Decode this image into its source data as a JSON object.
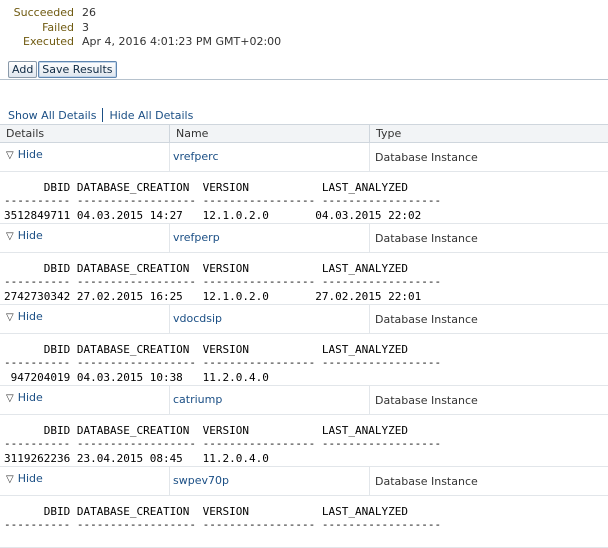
{
  "summary": {
    "succeeded_label": "Succeeded",
    "succeeded_value": "26",
    "failed_label": "Failed",
    "failed_value": "3",
    "executed_label": "Executed",
    "executed_value": "Apr 4, 2016 4:01:23 PM GMT+02:00"
  },
  "toolbar": {
    "add_label": "Add",
    "save_label": "Save Results"
  },
  "links": {
    "show_all": "Show All Details",
    "hide_all": "Hide All Details"
  },
  "table": {
    "columns": [
      "Details",
      "Name",
      "Type"
    ],
    "toggle_label": "Hide",
    "detail_header": "      DBID DATABASE_CREATION  VERSION           LAST_ANALYZED",
    "detail_dashes": "---------- ------------------ ----------------- ------------------",
    "rows": [
      {
        "name": "vrefperc",
        "type": "Database Instance",
        "value_line": "3512849711 04.03.2015 14:27   12.1.0.2.0       04.03.2015 22:02"
      },
      {
        "name": "vrefperp",
        "type": "Database Instance",
        "value_line": "2742730342 27.02.2015 16:25   12.1.0.2.0       27.02.2015 22:01"
      },
      {
        "name": "vdocdsip",
        "type": "Database Instance",
        "value_line": " 947204019 04.03.2015 10:38   11.2.0.4.0"
      },
      {
        "name": "catriump",
        "type": "Database Instance",
        "value_line": "3119262236 23.04.2015 08:45   11.2.0.4.0"
      },
      {
        "name": "swpev70p",
        "type": "Database Instance",
        "value_line": ""
      }
    ]
  }
}
